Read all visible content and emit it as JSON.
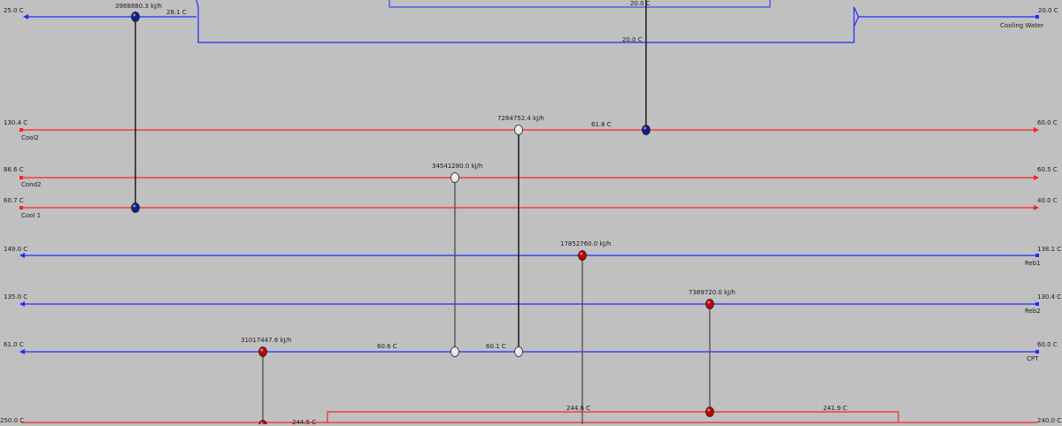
{
  "colors": {
    "cold": "#1e2bff",
    "hot": "#ff2020",
    "connector_dark": "#111111",
    "connector_gray": "#555555",
    "node_blue": "#0a1f8f",
    "node_red": "#c40000",
    "node_white": "#e8e8e8"
  },
  "diagram": {
    "cooling_water": {
      "name": "Cooling Water",
      "inlet_temp": "20.0 C",
      "outlet_temp": "25.0 C",
      "mid_temp_left": "28.1 C",
      "mid_temp_bottom": "20.0 C",
      "mid_temp_top": "20.0 C"
    },
    "streams": [
      {
        "id": "cool2",
        "name": "Cool2",
        "left_temp": "130.4 C",
        "right_temp": "60.0 C",
        "mid_temp": "61.8 C",
        "kind": "hot"
      },
      {
        "id": "cond2",
        "name": "Cond2",
        "left_temp": "86.6 C",
        "right_temp": "60.5 C",
        "kind": "hot"
      },
      {
        "id": "cool1",
        "name": "Cool 1",
        "left_temp": "60.7 C",
        "right_temp": "40.0 C",
        "kind": "hot"
      },
      {
        "id": "reb1",
        "name": "Reb1",
        "left_temp": "149.0 C",
        "right_temp": "138.1 C",
        "kind": "cold"
      },
      {
        "id": "reb2",
        "name": "Reb2",
        "left_temp": "135.0 C",
        "right_temp": "130.4 C",
        "kind": "cold"
      },
      {
        "id": "cpt",
        "name": "CPT",
        "left_temp": "61.0 C",
        "right_temp": "60.0 C",
        "mid_temps": [
          "60.6 C",
          "60.1 C"
        ],
        "kind": "cold"
      },
      {
        "id": "bottom",
        "name": "",
        "left_temp": "250.0 C",
        "right_temp": "240.0 C",
        "mid_temps": [
          "244.5 C",
          "244.6 C",
          "241.9 C"
        ],
        "kind": "hot"
      }
    ],
    "exchangers": [
      {
        "id": "ex1",
        "duty": "3988880.3 kJ/h"
      },
      {
        "id": "ex2",
        "duty": "7284752.4 kJ/h"
      },
      {
        "id": "ex3",
        "duty": "34541280.0 kJ/h"
      },
      {
        "id": "ex4",
        "duty": "17852760.0 kJ/h"
      },
      {
        "id": "ex5",
        "duty": "7389720.0 kJ/h"
      },
      {
        "id": "ex6",
        "duty": "31017447.6 kJ/h"
      }
    ]
  }
}
